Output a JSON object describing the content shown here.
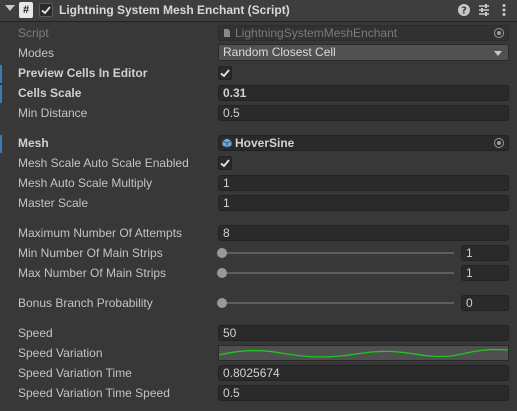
{
  "header": {
    "title": "Lightning System Mesh Enchant (Script)",
    "enabled": true,
    "script_icon_glyph": "#",
    "icons": [
      "help-icon",
      "presets-icon",
      "more-icon"
    ]
  },
  "fields": {
    "script": {
      "label": "Script",
      "value": "LightningSystemMeshEnchant"
    },
    "modes": {
      "label": "Modes",
      "value": "Random Closest Cell"
    },
    "preview_cells": {
      "label": "Preview Cells In Editor",
      "checked": true
    },
    "cells_scale": {
      "label": "Cells Scale",
      "value": "0.31"
    },
    "min_distance": {
      "label": "Min Distance",
      "value": "0.5"
    },
    "mesh": {
      "label": "Mesh",
      "value": "HoverSine"
    },
    "mesh_auto_scale": {
      "label": "Mesh Scale Auto Scale Enabled",
      "checked": true
    },
    "mesh_auto_scale_multiply": {
      "label": "Mesh Auto Scale Multiply",
      "value": "1"
    },
    "master_scale": {
      "label": "Master Scale",
      "value": "1"
    },
    "max_attempts": {
      "label": "Maximum Number Of Attempts",
      "value": "8"
    },
    "min_main_strips": {
      "label": "Min Number Of Main Strips",
      "value": "1",
      "slider_fraction": 0
    },
    "max_main_strips": {
      "label": "Max Number Of Main Strips",
      "value": "1",
      "slider_fraction": 0
    },
    "bonus_branch": {
      "label": "Bonus Branch Probability",
      "value": "0",
      "slider_fraction": 0
    },
    "speed": {
      "label": "Speed",
      "value": "50"
    },
    "speed_variation": {
      "label": "Speed Variation"
    },
    "speed_variation_time": {
      "label": "Speed Variation Time",
      "value": "0.8025674"
    },
    "speed_variation_time_speed": {
      "label": "Speed Variation Time Speed",
      "value": "0.5"
    }
  },
  "colors": {
    "curve": "#22c522",
    "modified_marker": "#3a79bb"
  }
}
